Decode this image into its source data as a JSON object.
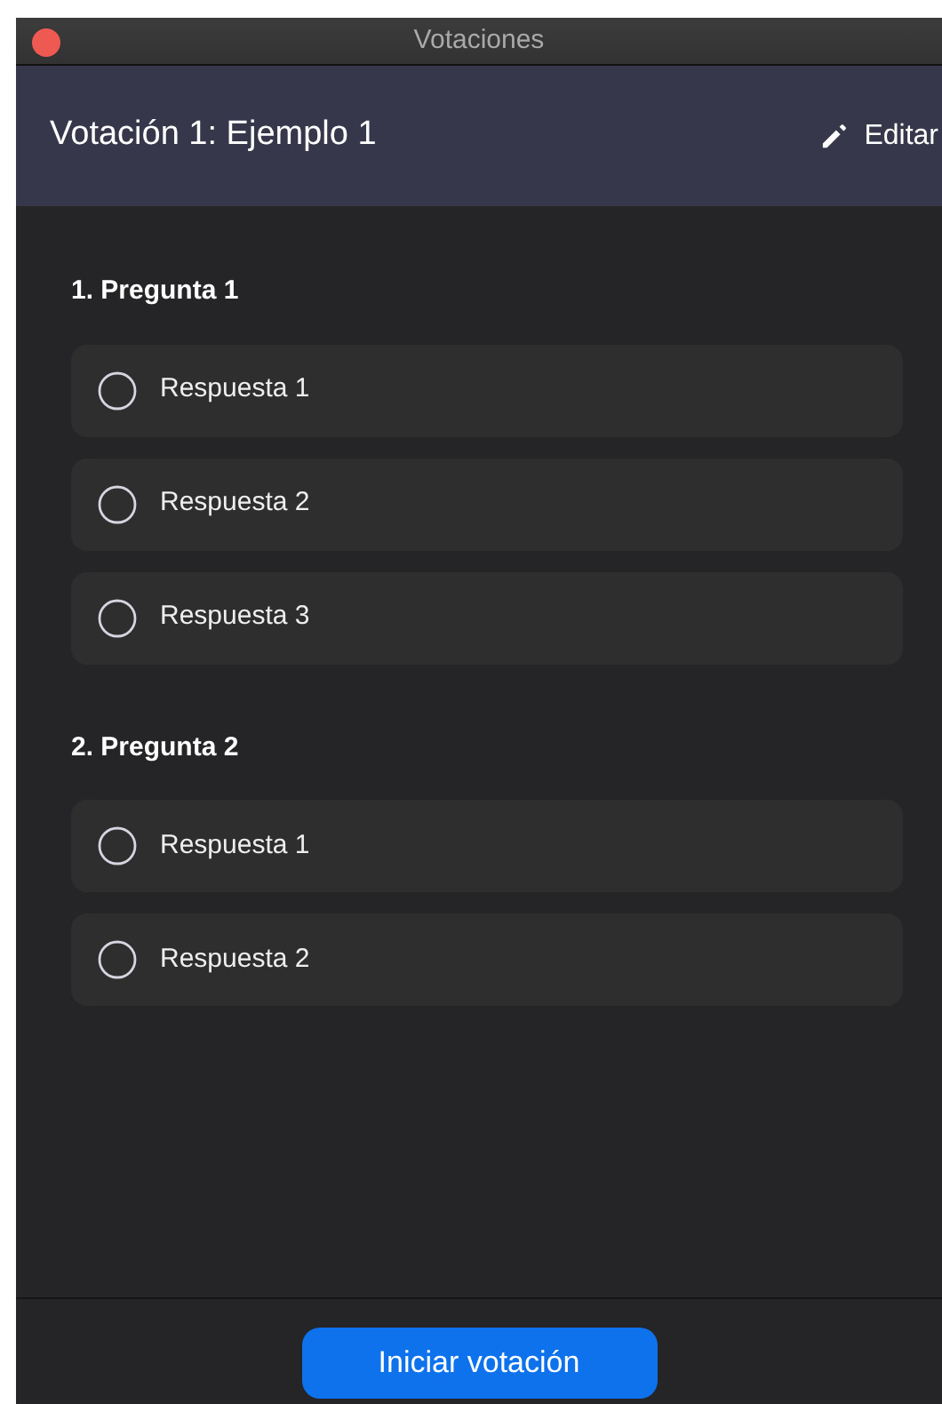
{
  "window": {
    "title": "Votaciones"
  },
  "header": {
    "title": "Votación 1: Ejemplo 1",
    "edit_label": "Editar"
  },
  "questions": [
    {
      "title": "1. Pregunta 1",
      "options": [
        {
          "label": "Respuesta 1",
          "selected": false
        },
        {
          "label": "Respuesta 2",
          "selected": false
        },
        {
          "label": "Respuesta 3",
          "selected": false
        }
      ]
    },
    {
      "title": "2. Pregunta 2",
      "options": [
        {
          "label": "Respuesta 1",
          "selected": false
        },
        {
          "label": "Respuesta 2",
          "selected": false
        }
      ]
    }
  ],
  "footer": {
    "button": "Iniciar votación"
  }
}
